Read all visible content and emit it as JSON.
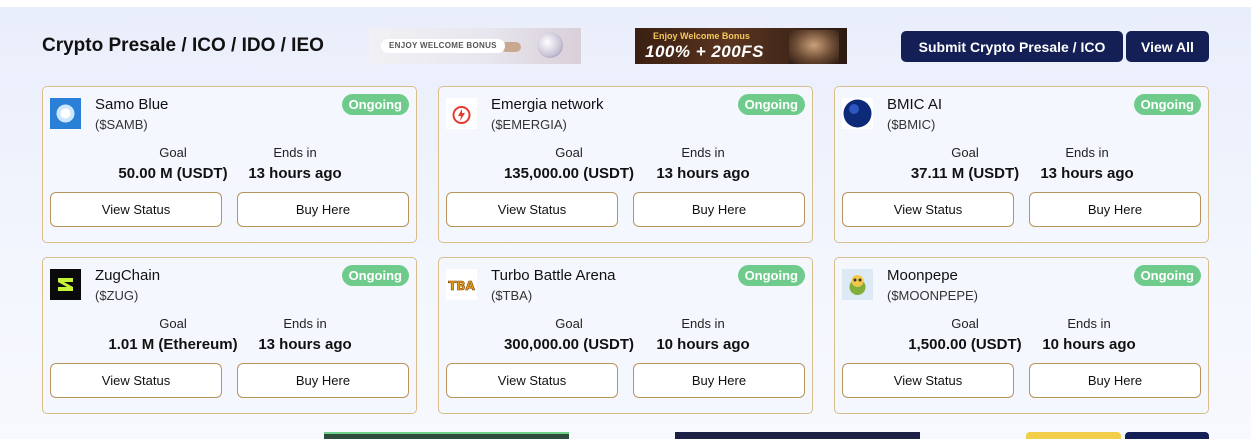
{
  "header": {
    "title": "Crypto Presale / ICO / IDO / IEO",
    "banner1_text": "ENJOY WELCOME BONUS",
    "banner2_line1": "Enjoy Welcome Bonus",
    "banner2_line2": "100% + 200FS",
    "submit_label": "Submit Crypto Presale / ICO",
    "view_all_label": "View All"
  },
  "labels": {
    "goal": "Goal",
    "ends_in": "Ends in",
    "view_status": "View Status",
    "buy_here": "Buy Here"
  },
  "cards": [
    {
      "name": "Samo Blue",
      "ticker": "($SAMB)",
      "status": "Ongoing",
      "goal": "50.00 M (USDT)",
      "ends": "13 hours ago",
      "icon": "samo-blue-logo-icon"
    },
    {
      "name": "Emergia network",
      "ticker": "($EMERGIA)",
      "status": "Ongoing",
      "goal": "135,000.00 (USDT)",
      "ends": "13 hours ago",
      "icon": "emergia-logo-icon"
    },
    {
      "name": "BMIC AI",
      "ticker": "($BMIC)",
      "status": "Ongoing",
      "goal": "37.11 M (USDT)",
      "ends": "13 hours ago",
      "icon": "bmic-logo-icon"
    },
    {
      "name": "ZugChain",
      "ticker": "($ZUG)",
      "status": "Ongoing",
      "goal": "1.01 M (Ethereum)",
      "ends": "13 hours ago",
      "icon": "zugchain-logo-icon"
    },
    {
      "name": "Turbo Battle Arena",
      "ticker": "($TBA)",
      "status": "Ongoing",
      "goal": "300,000.00 (USDT)",
      "ends": "10 hours ago",
      "icon": "tba-logo-icon"
    },
    {
      "name": "Moonpepe",
      "ticker": "($MOONPEPE)",
      "status": "Ongoing",
      "goal": "1,500.00 (USDT)",
      "ends": "10 hours ago",
      "icon": "moonpepe-logo-icon"
    }
  ],
  "colors": {
    "badge": "#6fcb8c",
    "accent_dark": "#142055",
    "card_border": "#d8be8c"
  }
}
